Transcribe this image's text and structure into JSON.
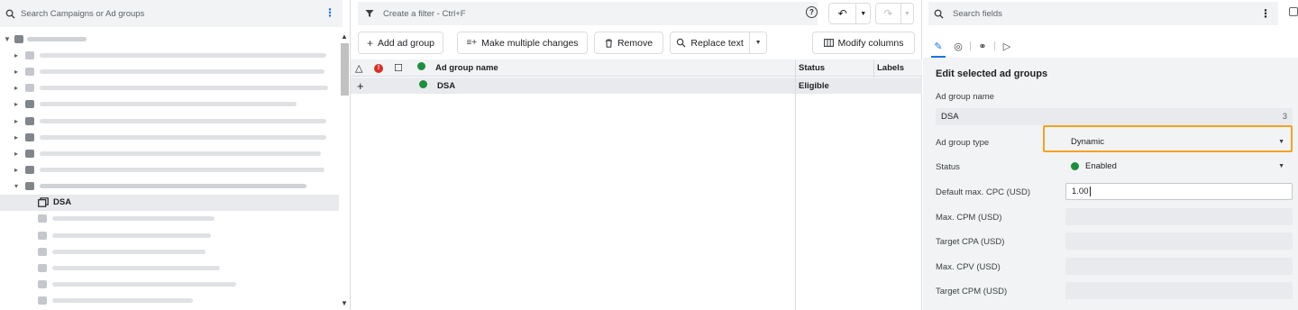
{
  "left_panel": {
    "search_placeholder": "Search Campaigns or Ad groups",
    "selected_item": "DSA"
  },
  "toolbar": {
    "filter_placeholder": "Create a filter - Ctrl+F",
    "help_icon": "?",
    "add_ad_group": "Add ad group",
    "make_multiple_changes": "Make multiple changes",
    "remove": "Remove",
    "replace_text": "Replace text",
    "modify_columns": "Modify columns"
  },
  "table": {
    "columns": [
      "Ad group name",
      "Status",
      "Labels"
    ],
    "rows": [
      {
        "name": "DSA",
        "status": "Eligible"
      }
    ]
  },
  "right_panel": {
    "search_placeholder": "Search fields",
    "title": "Edit selected ad groups",
    "fields": {
      "ad_group_name_label": "Ad group name",
      "ad_group_name_value": "DSA",
      "ad_group_name_count": "3",
      "ad_group_type_label": "Ad group type",
      "ad_group_type_value": "Dynamic",
      "status_label": "Status",
      "status_value": "Enabled",
      "default_cpc_label": "Default max. CPC (USD)",
      "default_cpc_value": "1.00",
      "max_cpm_label": "Max. CPM (USD)",
      "target_cpa_label": "Target CPA (USD)",
      "max_cpv_label": "Max. CPV (USD)",
      "target_cpm_label": "Target CPM (USD)"
    }
  },
  "colors": {
    "accent": "#1a73e8",
    "highlight": "#f4a31f",
    "enabled_green": "#1e8e3e",
    "error_red": "#d93025"
  }
}
